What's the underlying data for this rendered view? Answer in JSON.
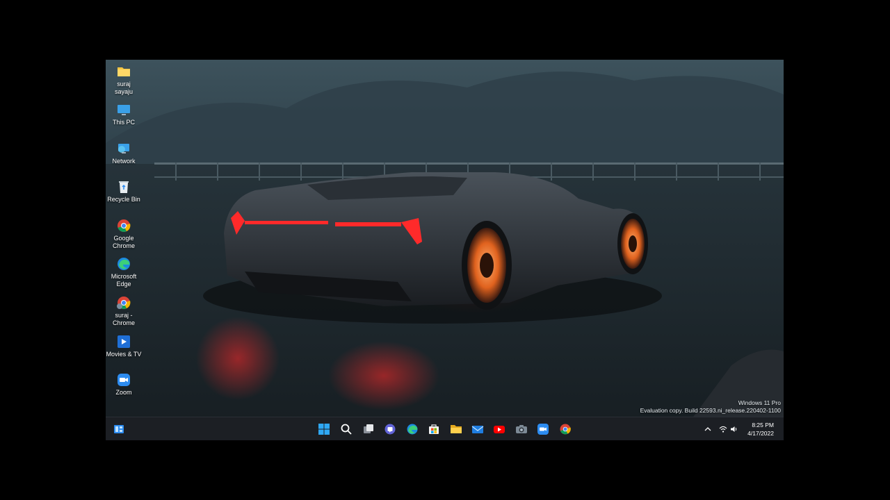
{
  "desktop": {
    "icons": [
      {
        "label": "suraj sayaju",
        "icon": "folder-icon"
      },
      {
        "label": "This PC",
        "icon": "monitor-icon"
      },
      {
        "label": "Network",
        "icon": "network-icon"
      },
      {
        "label": "Recycle Bin",
        "icon": "recycle-bin-icon"
      },
      {
        "label": "Google Chrome",
        "icon": "chrome-icon"
      },
      {
        "label": "Microsoft Edge",
        "icon": "edge-icon"
      },
      {
        "label": "suraj - Chrome",
        "icon": "chrome-profile-icon"
      },
      {
        "label": "Movies & TV",
        "icon": "movies-tv-icon"
      },
      {
        "label": "Zoom",
        "icon": "zoom-icon"
      }
    ],
    "watermark": {
      "line1": "Windows 11 Pro",
      "line2": "Evaluation copy. Build 22593.ni_release.220402-1100"
    }
  },
  "taskbar": {
    "left_widget": "widgets-icon",
    "apps": [
      "start-icon",
      "search-icon",
      "task-view-icon",
      "teams-chat-icon",
      "edge-icon",
      "store-icon",
      "file-explorer-icon",
      "mail-icon",
      "youtube-icon",
      "camera-icon",
      "zoom-icon",
      "chrome-icon"
    ],
    "tray": [
      "chevron-up-icon",
      "wifi-icon",
      "volume-icon"
    ],
    "clock": {
      "time": "8:25 PM",
      "date": "4/17/2022"
    }
  },
  "colors": {
    "taskbar_bg": "#1c1f24",
    "accent_blue": "#2d8cf0",
    "tail_light_red": "#ff2a2a"
  }
}
